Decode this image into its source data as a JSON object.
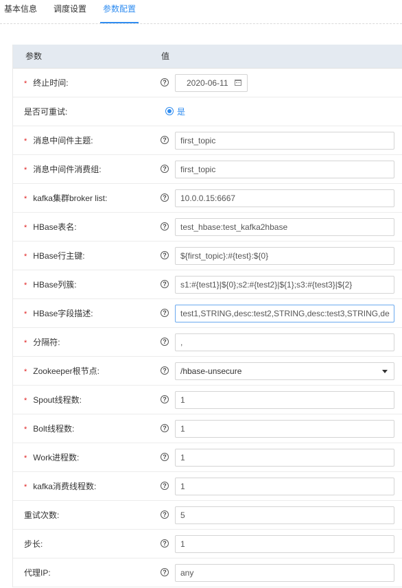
{
  "tabs": [
    {
      "label": "基本信息",
      "active": false
    },
    {
      "label": "调度设置",
      "active": false
    },
    {
      "label": "参数配置",
      "active": true
    }
  ],
  "table": {
    "col_param": "参数",
    "col_value": "值"
  },
  "rows": {
    "end_time": {
      "label": "终止时间:",
      "required": true,
      "value": "2020-06-11"
    },
    "retryable": {
      "label": "是否可重试:",
      "required": false,
      "option": "是",
      "selected": true
    },
    "mq_topic": {
      "label": "消息中间件主题:",
      "required": true,
      "value": "first_topic"
    },
    "mq_group": {
      "label": "消息中间件消费组:",
      "required": true,
      "value": "first_topic"
    },
    "kafka_brokers": {
      "label": "kafka集群broker list:",
      "required": true,
      "value": "10.0.0.15:6667"
    },
    "hbase_table": {
      "label": "HBase表名:",
      "required": true,
      "value": "test_hbase:test_kafka2hbase"
    },
    "hbase_rowkey": {
      "label": "HBase行主键:",
      "required": true,
      "value": "${first_topic}:#{test}:${0}"
    },
    "hbase_family": {
      "label": "HBase列簇:",
      "required": true,
      "value": "s1:#{test1}|${0};s2:#{test2}|${1};s3:#{test3}|${2}"
    },
    "hbase_fields": {
      "label": "HBase字段描述:",
      "required": true,
      "value": "test1,STRING,desc:test2,STRING,desc:test3,STRING,de"
    },
    "separator": {
      "label": "分隔符:",
      "required": true,
      "value": ","
    },
    "zk_node": {
      "label": "Zookeeper根节点:",
      "required": true,
      "value": "/hbase-unsecure"
    },
    "spout_threads": {
      "label": "Spout线程数:",
      "required": true,
      "value": "1"
    },
    "bolt_threads": {
      "label": "Bolt线程数:",
      "required": true,
      "value": "1"
    },
    "work_procs": {
      "label": "Work进程数:",
      "required": true,
      "value": "1"
    },
    "kafka_threads": {
      "label": "kafka消费线程数:",
      "required": true,
      "value": "1"
    },
    "retry_count": {
      "label": "重试次数:",
      "required": false,
      "value": "5"
    },
    "step": {
      "label": "步长:",
      "required": false,
      "value": "1"
    },
    "proxy_ip": {
      "label": "代理IP:",
      "required": false,
      "value": "any"
    }
  },
  "icons": {
    "help": "question-circle-icon",
    "required_mark": "*",
    "help_glyph": "?",
    "calendar": "calendar-icon",
    "dropdown": "chevron-down-icon"
  },
  "colors": {
    "accent": "#2f8cf0",
    "required": "#e02020",
    "header_bg": "#e4eaf1"
  }
}
